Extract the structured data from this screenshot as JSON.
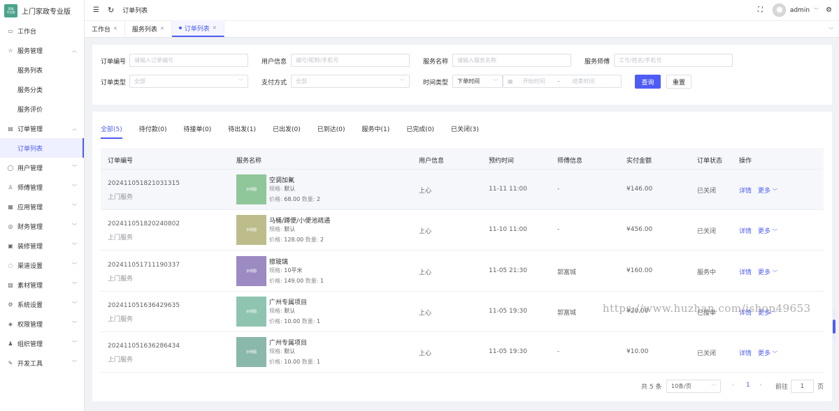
{
  "app": {
    "logo_text": "家政\n专业版",
    "title": "上门家政专业版"
  },
  "sidebar": {
    "items": [
      {
        "icon": "monitor-icon",
        "label": "工作台",
        "arrow": ""
      },
      {
        "icon": "star-icon",
        "label": "服务管理",
        "arrow": "up"
      },
      {
        "label": "服务列表",
        "sub": true
      },
      {
        "label": "服务分类",
        "sub": true
      },
      {
        "label": "服务评价",
        "sub": true
      },
      {
        "icon": "document-icon",
        "label": "订单管理",
        "arrow": "up"
      },
      {
        "label": "订单列表",
        "sub": true,
        "active": true
      },
      {
        "icon": "user-icon",
        "label": "用户管理",
        "arrow": "down"
      },
      {
        "icon": "worker-icon",
        "label": "师傅管理",
        "arrow": "down"
      },
      {
        "icon": "grid-icon",
        "label": "应用管理",
        "arrow": "down"
      },
      {
        "icon": "finance-icon",
        "label": "财务管理",
        "arrow": "down"
      },
      {
        "icon": "decoration-icon",
        "label": "装修管理",
        "arrow": "down"
      },
      {
        "icon": "chat-icon",
        "label": "渠道设置",
        "arrow": "down"
      },
      {
        "icon": "image-icon",
        "label": "素材管理",
        "arrow": "down"
      },
      {
        "icon": "gear-icon",
        "label": "系统设置",
        "arrow": "down"
      },
      {
        "icon": "shield-icon",
        "label": "权限管理",
        "arrow": "down"
      },
      {
        "icon": "org-icon",
        "label": "组织管理",
        "arrow": "down"
      },
      {
        "icon": "pen-icon",
        "label": "开发工具",
        "arrow": "down"
      }
    ]
  },
  "topbar": {
    "breadcrumb": "订单列表",
    "user": "admin"
  },
  "tabs": [
    {
      "label": "工作台",
      "active": false
    },
    {
      "label": "服务列表",
      "active": false
    },
    {
      "label": "订单列表",
      "active": true
    }
  ],
  "filter": {
    "order_no_label": "订单编号",
    "order_no_placeholder": "请输入订单编号",
    "user_label": "用户信息",
    "user_placeholder": "编号/昵称/手机号",
    "service_label": "服务名称",
    "service_placeholder": "请输入服务名称",
    "worker_label": "服务师傅",
    "worker_placeholder": "工号/姓名/手机号",
    "type_label": "订单类型",
    "type_value": "全部",
    "pay_label": "支付方式",
    "pay_value": "全部",
    "time_label": "时间类型",
    "time_type_value": "下单时间",
    "start_placeholder": "开始时间",
    "range_sep": "-",
    "end_placeholder": "结束时间",
    "search_btn": "查询",
    "reset_btn": "重置"
  },
  "status_tabs": [
    "全部(5)",
    "待付款(0)",
    "待接单(0)",
    "待出发(1)",
    "已出发(0)",
    "已到达(0)",
    "服务中(1)",
    "已完成(0)",
    "已关闭(3)"
  ],
  "table": {
    "headers": [
      "订单编号",
      "服务名称",
      "用户信息",
      "预约时间",
      "师傅信息",
      "实付金额",
      "订单状态",
      "操作"
    ],
    "spec_label": "规格:",
    "price_label": "价格:",
    "qty_label": "数量:",
    "thumb_text": "示例图",
    "detail_label": "详情",
    "more_label": "更多",
    "rows": [
      {
        "order_no": "202411051821031315",
        "type": "上门服务",
        "service": "空调加氟",
        "spec": "默认",
        "price": "68.00",
        "qty": "2",
        "user": "上心",
        "time": "11-11 11:00",
        "worker": "-",
        "amount": "¥146.00",
        "status": "已关闭",
        "thumb_color": "#8fc79a"
      },
      {
        "order_no": "202411051820240802",
        "type": "上门服务",
        "service": "马桶/蹲便/小便池疏通",
        "spec": "默认",
        "price": "128.00",
        "qty": "2",
        "user": "上心",
        "time": "11-10 11:00",
        "worker": "-",
        "amount": "¥456.00",
        "status": "已关闭",
        "thumb_color": "#bcbd8b"
      },
      {
        "order_no": "202411051711190337",
        "type": "上门服务",
        "service": "擦玻璃",
        "spec": "10平米",
        "price": "149.00",
        "qty": "1",
        "user": "上心",
        "time": "11-05 21:30",
        "worker": "郭富城",
        "amount": "¥160.00",
        "status": "服务中",
        "thumb_color": "#9c8ac2"
      },
      {
        "order_no": "202411051636429635",
        "type": "上门服务",
        "service": "广州专属项目",
        "spec": "默认",
        "price": "10.00",
        "qty": "1",
        "user": "上心",
        "time": "11-05 19:30",
        "worker": "郭富城",
        "amount": "¥20.00",
        "status": "已接单",
        "thumb_color": "#8ec4b0"
      },
      {
        "order_no": "202411051636286434",
        "type": "上门服务",
        "service": "广州专属项目",
        "spec": "默认",
        "price": "10.00",
        "qty": "1",
        "user": "上心",
        "time": "11-05 19:30",
        "worker": "-",
        "amount": "¥10.00",
        "status": "已关闭",
        "thumb_color": "#8ab8aa"
      }
    ]
  },
  "pagination": {
    "total": "共 5 条",
    "page_size": "10条/页",
    "current": "1",
    "goto_label": "前往",
    "goto_value": "1",
    "page_unit": "页"
  },
  "watermark": "https://www.huzhan.com/ishop49653",
  "colors": {
    "primary": "#4e5cf5"
  }
}
